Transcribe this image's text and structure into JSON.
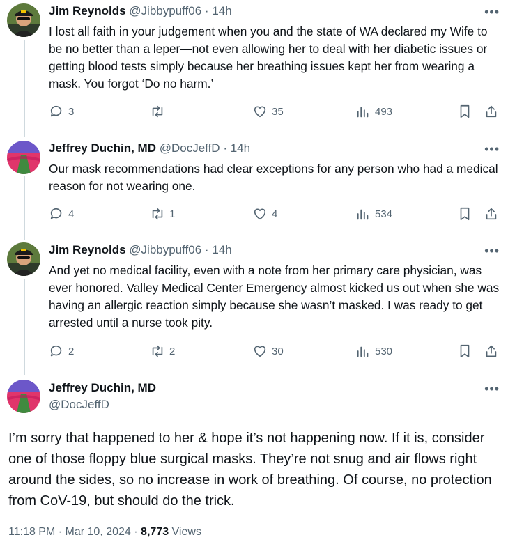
{
  "replies": [
    {
      "author": "Jim Reynolds",
      "handle": "@Jibbypuff06",
      "time": "14h",
      "text": "I lost all faith in your judgement when you and the state of WA declared my Wife to be no better than a leper—not even allowing her to deal with her diabetic issues or getting blood tests simply because her breathing issues kept her from wearing a mask. You forgot ‘Do no harm.’",
      "replies_count": "3",
      "reposts_count": "",
      "likes_count": "35",
      "views_count": "493"
    },
    {
      "author": "Jeffrey Duchin, MD",
      "handle": "@DocJeffD",
      "time": "14h",
      "text": "Our mask recommendations had clear exceptions for any person who had a medical reason for not wearing one.",
      "replies_count": "4",
      "reposts_count": "1",
      "likes_count": "4",
      "views_count": "534"
    },
    {
      "author": "Jim Reynolds",
      "handle": "@Jibbypuff06",
      "time": "14h",
      "text": "And yet no medical facility, even with a note from her primary care physician, was ever honored. Valley Medical Center Emergency almost kicked us out when she was having an allergic reaction simply because she wasn’t masked. I was ready to get arrested until a nurse took pity.",
      "replies_count": "2",
      "reposts_count": "2",
      "likes_count": "30",
      "views_count": "530"
    }
  ],
  "main": {
    "author": "Jeffrey Duchin, MD",
    "handle": "@DocJeffD",
    "text": "I’m sorry that happened to her & hope it’s not happening now.  If it is, consider one of those floppy blue surgical masks. They’re not snug and air flows right around the sides, so no increase in work of breathing. Of course, no protection from CoV-19, but should do the trick.",
    "time": "11:18 PM",
    "date": "Mar 10, 2024",
    "views": "8,773",
    "views_label": "Views"
  },
  "separator": "·",
  "more_glyph": "•••",
  "colors": {
    "text": "#0f1419",
    "muted": "#536471",
    "thread_line": "#cfd9de"
  },
  "icons": [
    "reply-icon",
    "repost-icon",
    "like-icon",
    "views-icon",
    "bookmark-icon",
    "share-icon",
    "more-icon"
  ]
}
